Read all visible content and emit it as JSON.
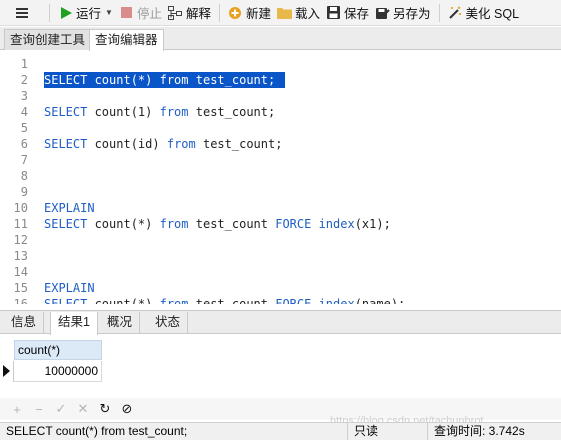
{
  "toolbar": {
    "run_label": "运行",
    "stop_label": "停止",
    "explain_label": "解释",
    "new_label": "新建",
    "load_label": "载入",
    "save_label": "保存",
    "saveas_label": "另存为",
    "beautify_label": "美化 SQL"
  },
  "tabs": [
    "查询创建工具",
    "查询编辑器"
  ],
  "editor": {
    "lines": [
      {
        "n": "1",
        "code": ""
      },
      {
        "n": "2",
        "code": "SELECT count(*) from test_count;"
      },
      {
        "n": "3",
        "code": ""
      },
      {
        "n": "4",
        "code": "SELECT count(1) from test_count;"
      },
      {
        "n": "5",
        "code": ""
      },
      {
        "n": "6",
        "code": "SELECT count(id) from test_count;"
      },
      {
        "n": "7",
        "code": ""
      },
      {
        "n": "8",
        "code": ""
      },
      {
        "n": "9",
        "code": ""
      },
      {
        "n": "10",
        "code": "EXPLAIN"
      },
      {
        "n": "11",
        "code": "SELECT count(*) from test_count FORCE index(x1);"
      },
      {
        "n": "12",
        "code": ""
      },
      {
        "n": "13",
        "code": ""
      },
      {
        "n": "14",
        "code": ""
      },
      {
        "n": "15",
        "code": "EXPLAIN"
      },
      {
        "n": "16",
        "code": "SELECT count(*) from test_count FORCE index(name);"
      }
    ],
    "selected_line": "2"
  },
  "result_tabs": [
    "信息",
    "结果1",
    "概况",
    "状态"
  ],
  "result": {
    "column": "count(*)",
    "value": "10000000"
  },
  "grid_buttons": [
    "+",
    "−",
    "✓",
    "✕",
    "↻",
    "⊘"
  ],
  "status": {
    "sql": "SELECT count(*) from test_count;",
    "mode": "只读",
    "time": "查询时间: 3.742s"
  },
  "watermark": "https://blog.csdn.net/tachunhrot",
  "colors": {
    "keyword": "#1f5fc4",
    "selection": "#0a56c8",
    "run_icon": "#22a022"
  }
}
